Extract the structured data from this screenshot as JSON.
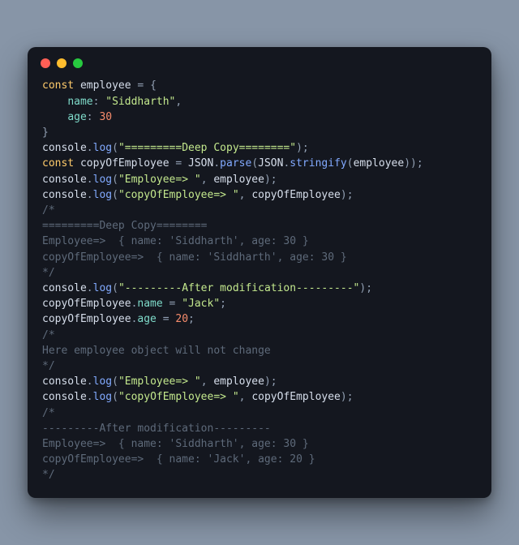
{
  "window": {
    "traffic_lights": [
      "red",
      "yellow",
      "green"
    ]
  },
  "code": {
    "kw_const": "const",
    "id_employee": "employee",
    "eq": " = ",
    "brace_open": "{",
    "indent": "    ",
    "prop_name": "name",
    "colon": ": ",
    "str_siddharth": "\"Siddharth\"",
    "comma": ",",
    "prop_age": "age",
    "num_30": "30",
    "brace_close": "}",
    "id_console": "console",
    "dot": ".",
    "fn_log": "log",
    "paren_open": "(",
    "paren_close": ")",
    "semicolon": ";",
    "str_deep_header": "\"=========Deep Copy========\"",
    "id_copyOfEmployee": "copyOfEmployee",
    "id_JSON": "JSON",
    "fn_parse": "parse",
    "fn_stringify": "stringify",
    "str_employee_lbl": "\"Employee=> \"",
    "str_copy_lbl": "\"copyOfEmployee=> \"",
    "comm_block_open": "/*",
    "comm_block_close": "*/",
    "comm_deep_header": "=========Deep Copy========",
    "comm_emp_line": "Employee=>  { name: 'Siddharth', age: 30 }",
    "comm_copy_line": "copyOfEmployee=>  { name: 'Siddharth', age: 30 }",
    "str_after_header": "\"---------After modification---------\"",
    "str_jack": "\"Jack\"",
    "num_20": "20",
    "comm_note": "Here employee object will not change",
    "comm_after_header": "---------After modification---------",
    "comm_emp_line2": "Employee=>  { name: 'Siddharth', age: 30 }",
    "comm_copy_line2": "copyOfEmployee=>  { name: 'Jack', age: 20 }",
    "comma_sp": ", "
  }
}
